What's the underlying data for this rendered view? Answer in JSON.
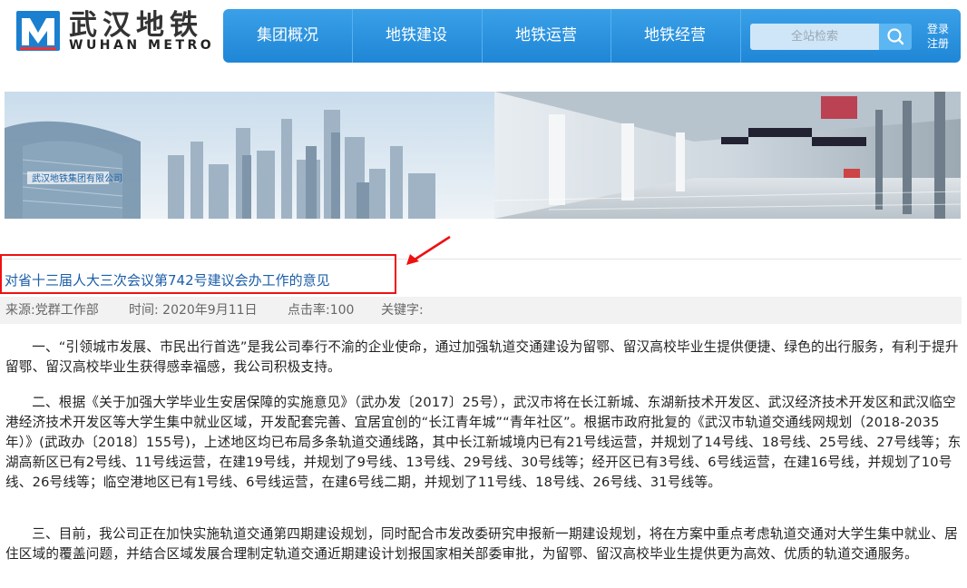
{
  "logo": {
    "cn": "武汉地铁",
    "en": "WUHAN METRO"
  },
  "nav": {
    "items": [
      "集团概况",
      "地铁建设",
      "地铁运营",
      "地铁经营"
    ],
    "search_placeholder": "全站检索",
    "login": "登录",
    "register": "注册"
  },
  "banner": {
    "company_text": "武汉地铁集团有限公司"
  },
  "article": {
    "title": "对省十三届人大三次会议第742号建议会办工作的意见",
    "source": "来源:党群工作部",
    "time": "时间: 2020年9月11日",
    "clicks": "点击率:100",
    "keywords": "关键字:",
    "paragraphs": [
      "一、“引领城市发展、市民出行首选”是我公司奉行不渝的企业使命，通过加强轨道交通建设为留鄂、留汉高校毕业生提供便捷、绿色的出行服务，有利于提升留鄂、留汉高校毕业生获得感幸福感，我公司积极支持。",
      "二、根据《关于加强大学毕业生安居保障的实施意见》（武办发〔2017〕25号），武汉市将在长江新城、东湖新技术开发区、武汉经济技术开发区和武汉临空港经济技术开发区等大学生集中就业区域，开发配套完善、宜居宜创的“长江青年城”“青年社区”。根据市政府批复的《武汉市轨道交通线网规划（2018-2035年）》(武政办〔2018〕155号)，上述地区均已布局多条轨道交通线路，其中长江新城境内已有21号线运营，并规划了14号线、18号线、25号线、27号线等；东湖高新区已有2号线、11号线运营，在建19号线，并规划了9号线、13号线、29号线、30号线等；经开区已有3号线、6号线运营，在建16号线，并规划了10号线、26号线等；临空港地区已有1号线、6号线运营，在建6号线二期，并规划了11号线、18号线、26号线、31号线等。",
      "三、目前，我公司正在加快实施轨道交通第四期建设规划，同时配合市发改委研究申报新一期建设规划，将在方案中重点考虑轨道交通对大学生集中就业、居住区域的覆盖问题，并结合区域发展合理制定轨道交通近期建设计划报国家相关部委审批，为留鄂、留汉高校毕业生提供更为高效、优质的轨道交通服务。"
    ]
  },
  "colors": {
    "nav": "#2a93e0",
    "title": "#1a5ea8",
    "highlight": "#e11111"
  }
}
